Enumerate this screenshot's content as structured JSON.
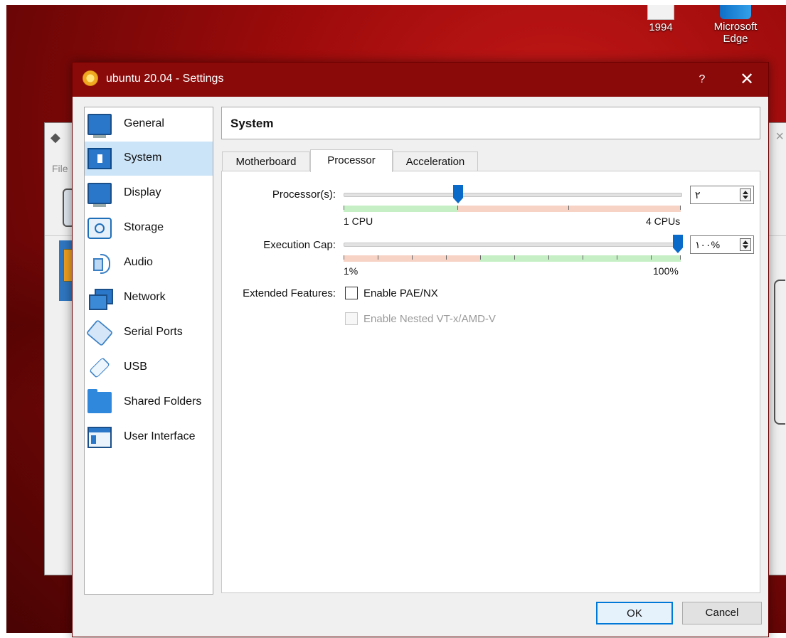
{
  "desktop": {
    "icons": [
      {
        "label": "1994"
      },
      {
        "label_line1": "Microsoft",
        "label_line2": "Edge"
      }
    ]
  },
  "background_window": {
    "menu_file": "File"
  },
  "dialog": {
    "title": "ubuntu 20.04 - Settings",
    "help_label": "?",
    "close_label": "✕",
    "categories": [
      {
        "label": "General",
        "icon": "general-icon"
      },
      {
        "label": "System",
        "icon": "system-icon",
        "selected": true
      },
      {
        "label": "Display",
        "icon": "display-icon"
      },
      {
        "label": "Storage",
        "icon": "storage-icon"
      },
      {
        "label": "Audio",
        "icon": "audio-icon"
      },
      {
        "label": "Network",
        "icon": "network-icon"
      },
      {
        "label": "Serial Ports",
        "icon": "serial-ports-icon"
      },
      {
        "label": "USB",
        "icon": "usb-icon"
      },
      {
        "label": "Shared Folders",
        "icon": "shared-folders-icon"
      },
      {
        "label": "User Interface",
        "icon": "user-interface-icon"
      }
    ],
    "section_title": "System",
    "tabs": [
      {
        "label": "Motherboard"
      },
      {
        "label": "Processor",
        "active": true
      },
      {
        "label": "Acceleration"
      }
    ],
    "processors": {
      "label": "Processor(s):",
      "min_label": "1 CPU",
      "max_label": "4 CPUs",
      "value_text": "٢",
      "value": 2,
      "min": 1,
      "max": 4
    },
    "execution_cap": {
      "label": "Execution Cap:",
      "min_label": "1%",
      "max_label": "100%",
      "value_text": "١٠٠%",
      "value": 100,
      "min": 1,
      "max": 100
    },
    "extended_features": {
      "label": "Extended Features:",
      "pae_nx": {
        "label": "Enable PAE/NX",
        "checked": false,
        "enabled": true
      },
      "nested_vt": {
        "label": "Enable Nested VT-x/AMD-V",
        "checked": false,
        "enabled": false
      }
    },
    "buttons": {
      "ok": "OK",
      "cancel": "Cancel"
    },
    "colors": {
      "titlebar": "#8a0a0a",
      "selected_item": "#cce4f7",
      "slider_thumb": "#0a6ac9",
      "range_good": "#c6efc6",
      "range_bad": "#f7d3c6"
    }
  }
}
